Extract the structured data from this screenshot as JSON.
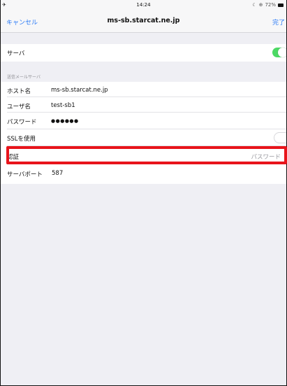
{
  "status_bar": {
    "signal": "✈",
    "time": "14:24",
    "battery_text": "72%"
  },
  "nav": {
    "cancel_label": "キャンセル",
    "title": "ms-sb.starcat.ne.jp",
    "done_label": "完了"
  },
  "server_row": {
    "label": "サーバ",
    "enabled": true
  },
  "section_header": "送信メールサーバ",
  "fields": {
    "host": {
      "label": "ホスト名",
      "value": "ms-sb.starcat.ne.jp"
    },
    "user": {
      "label": "ユーザ名",
      "value": "test-sb1"
    },
    "password": {
      "label": "パスワード",
      "value": "●●●●●●"
    },
    "ssl": {
      "label": "SSLを使用",
      "enabled": false
    },
    "auth": {
      "label": "認証",
      "value": "パスワード"
    },
    "port": {
      "label": "サーバポート",
      "value": "587"
    }
  },
  "colors": {
    "accent": "#2d7cf6",
    "toggle_on": "#4cd964",
    "highlight": "#e8141b"
  }
}
